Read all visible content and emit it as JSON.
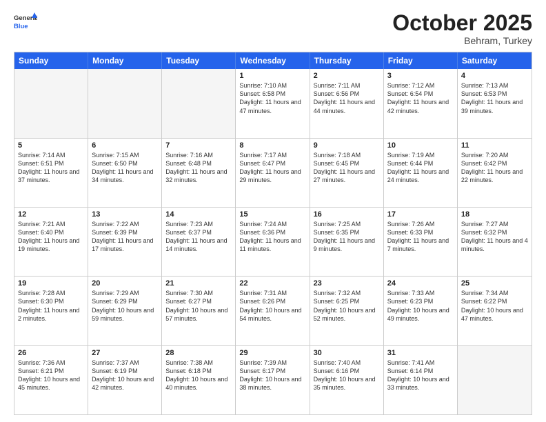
{
  "logo": {
    "general": "General",
    "blue": "Blue"
  },
  "title": "October 2025",
  "subtitle": "Behram, Turkey",
  "headers": [
    "Sunday",
    "Monday",
    "Tuesday",
    "Wednesday",
    "Thursday",
    "Friday",
    "Saturday"
  ],
  "rows": [
    [
      {
        "day": "",
        "info": "",
        "empty": true
      },
      {
        "day": "",
        "info": "",
        "empty": true
      },
      {
        "day": "",
        "info": "",
        "empty": true
      },
      {
        "day": "1",
        "info": "Sunrise: 7:10 AM\nSunset: 6:58 PM\nDaylight: 11 hours and 47 minutes.",
        "empty": false
      },
      {
        "day": "2",
        "info": "Sunrise: 7:11 AM\nSunset: 6:56 PM\nDaylight: 11 hours and 44 minutes.",
        "empty": false
      },
      {
        "day": "3",
        "info": "Sunrise: 7:12 AM\nSunset: 6:54 PM\nDaylight: 11 hours and 42 minutes.",
        "empty": false
      },
      {
        "day": "4",
        "info": "Sunrise: 7:13 AM\nSunset: 6:53 PM\nDaylight: 11 hours and 39 minutes.",
        "empty": false
      }
    ],
    [
      {
        "day": "5",
        "info": "Sunrise: 7:14 AM\nSunset: 6:51 PM\nDaylight: 11 hours and 37 minutes.",
        "empty": false
      },
      {
        "day": "6",
        "info": "Sunrise: 7:15 AM\nSunset: 6:50 PM\nDaylight: 11 hours and 34 minutes.",
        "empty": false
      },
      {
        "day": "7",
        "info": "Sunrise: 7:16 AM\nSunset: 6:48 PM\nDaylight: 11 hours and 32 minutes.",
        "empty": false
      },
      {
        "day": "8",
        "info": "Sunrise: 7:17 AM\nSunset: 6:47 PM\nDaylight: 11 hours and 29 minutes.",
        "empty": false
      },
      {
        "day": "9",
        "info": "Sunrise: 7:18 AM\nSunset: 6:45 PM\nDaylight: 11 hours and 27 minutes.",
        "empty": false
      },
      {
        "day": "10",
        "info": "Sunrise: 7:19 AM\nSunset: 6:44 PM\nDaylight: 11 hours and 24 minutes.",
        "empty": false
      },
      {
        "day": "11",
        "info": "Sunrise: 7:20 AM\nSunset: 6:42 PM\nDaylight: 11 hours and 22 minutes.",
        "empty": false
      }
    ],
    [
      {
        "day": "12",
        "info": "Sunrise: 7:21 AM\nSunset: 6:40 PM\nDaylight: 11 hours and 19 minutes.",
        "empty": false
      },
      {
        "day": "13",
        "info": "Sunrise: 7:22 AM\nSunset: 6:39 PM\nDaylight: 11 hours and 17 minutes.",
        "empty": false
      },
      {
        "day": "14",
        "info": "Sunrise: 7:23 AM\nSunset: 6:37 PM\nDaylight: 11 hours and 14 minutes.",
        "empty": false
      },
      {
        "day": "15",
        "info": "Sunrise: 7:24 AM\nSunset: 6:36 PM\nDaylight: 11 hours and 11 minutes.",
        "empty": false
      },
      {
        "day": "16",
        "info": "Sunrise: 7:25 AM\nSunset: 6:35 PM\nDaylight: 11 hours and 9 minutes.",
        "empty": false
      },
      {
        "day": "17",
        "info": "Sunrise: 7:26 AM\nSunset: 6:33 PM\nDaylight: 11 hours and 7 minutes.",
        "empty": false
      },
      {
        "day": "18",
        "info": "Sunrise: 7:27 AM\nSunset: 6:32 PM\nDaylight: 11 hours and 4 minutes.",
        "empty": false
      }
    ],
    [
      {
        "day": "19",
        "info": "Sunrise: 7:28 AM\nSunset: 6:30 PM\nDaylight: 11 hours and 2 minutes.",
        "empty": false
      },
      {
        "day": "20",
        "info": "Sunrise: 7:29 AM\nSunset: 6:29 PM\nDaylight: 10 hours and 59 minutes.",
        "empty": false
      },
      {
        "day": "21",
        "info": "Sunrise: 7:30 AM\nSunset: 6:27 PM\nDaylight: 10 hours and 57 minutes.",
        "empty": false
      },
      {
        "day": "22",
        "info": "Sunrise: 7:31 AM\nSunset: 6:26 PM\nDaylight: 10 hours and 54 minutes.",
        "empty": false
      },
      {
        "day": "23",
        "info": "Sunrise: 7:32 AM\nSunset: 6:25 PM\nDaylight: 10 hours and 52 minutes.",
        "empty": false
      },
      {
        "day": "24",
        "info": "Sunrise: 7:33 AM\nSunset: 6:23 PM\nDaylight: 10 hours and 49 minutes.",
        "empty": false
      },
      {
        "day": "25",
        "info": "Sunrise: 7:34 AM\nSunset: 6:22 PM\nDaylight: 10 hours and 47 minutes.",
        "empty": false
      }
    ],
    [
      {
        "day": "26",
        "info": "Sunrise: 7:36 AM\nSunset: 6:21 PM\nDaylight: 10 hours and 45 minutes.",
        "empty": false
      },
      {
        "day": "27",
        "info": "Sunrise: 7:37 AM\nSunset: 6:19 PM\nDaylight: 10 hours and 42 minutes.",
        "empty": false
      },
      {
        "day": "28",
        "info": "Sunrise: 7:38 AM\nSunset: 6:18 PM\nDaylight: 10 hours and 40 minutes.",
        "empty": false
      },
      {
        "day": "29",
        "info": "Sunrise: 7:39 AM\nSunset: 6:17 PM\nDaylight: 10 hours and 38 minutes.",
        "empty": false
      },
      {
        "day": "30",
        "info": "Sunrise: 7:40 AM\nSunset: 6:16 PM\nDaylight: 10 hours and 35 minutes.",
        "empty": false
      },
      {
        "day": "31",
        "info": "Sunrise: 7:41 AM\nSunset: 6:14 PM\nDaylight: 10 hours and 33 minutes.",
        "empty": false
      },
      {
        "day": "",
        "info": "",
        "empty": true
      }
    ]
  ]
}
